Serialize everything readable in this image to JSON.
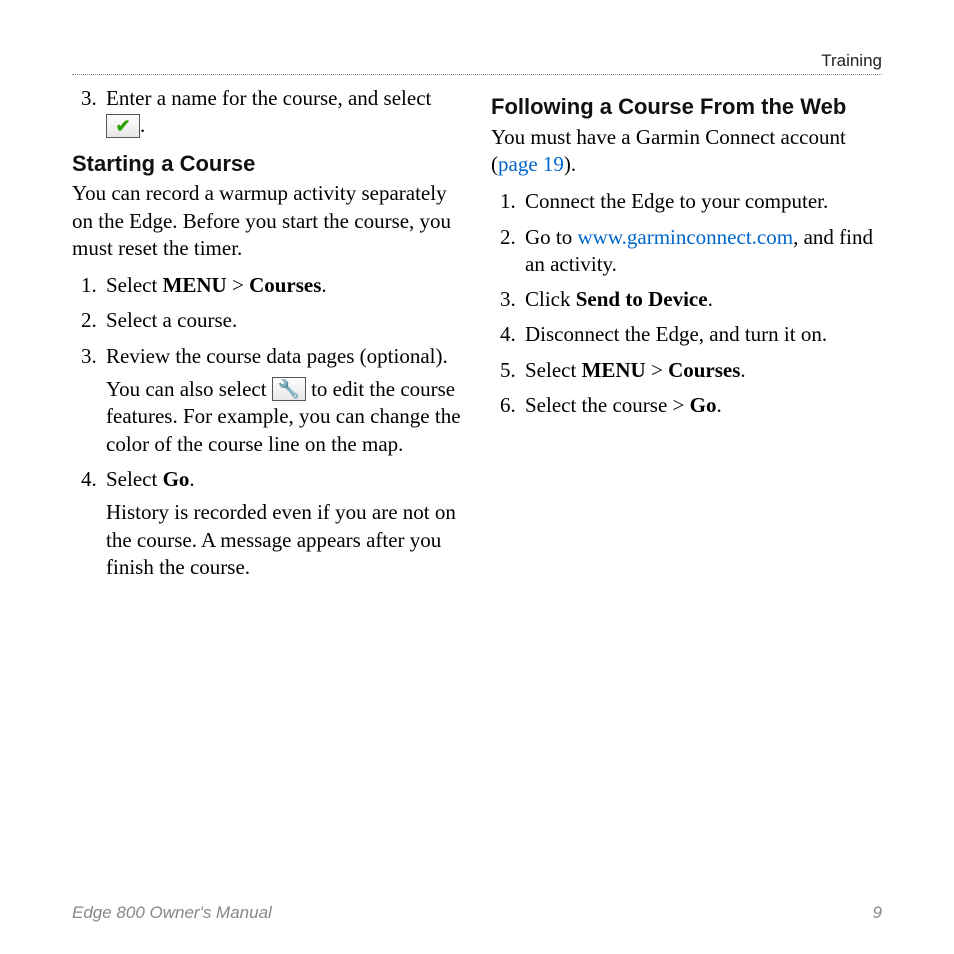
{
  "header": {
    "section": "Training"
  },
  "left": {
    "intro_item": {
      "num": "3.",
      "text_a": "Enter a name for the course, and select ",
      "text_b": "."
    },
    "heading1": "Starting a Course",
    "para1": "You can record a warmup activity separately on the Edge. Before you start the course, you must reset the timer.",
    "steps": {
      "s1": {
        "a": "Select ",
        "menu": "MENU",
        "gt": " > ",
        "courses": "Courses",
        "end": "."
      },
      "s2": "Select a course.",
      "s3": {
        "a": "Review the course data pages (optional).",
        "sub_a": "You can also select ",
        "sub_b": " to edit the course features. For example, you can change the color of the course line on the map."
      },
      "s4": {
        "a": "Select ",
        "go": "Go",
        "end": ".",
        "sub": "History is recorded even if you are not on the course. A message appears after you finish the course."
      }
    }
  },
  "right": {
    "heading1": "Following a Course From the Web",
    "para1": {
      "a": "You must have a Garmin Connect account (",
      "link": "page 19",
      "b": ")."
    },
    "steps": {
      "s1": "Connect the Edge to your computer.",
      "s2": {
        "a": "Go to ",
        "link": "www.garminconnect.com",
        "b": ", and find an activity."
      },
      "s3": {
        "a": "Click ",
        "bold": "Send to Device",
        "end": "."
      },
      "s4": "Disconnect the Edge, and turn it on.",
      "s5": {
        "a": "Select ",
        "menu": "MENU",
        "gt": " > ",
        "courses": "Courses",
        "end": "."
      },
      "s6": {
        "a": "Select the course > ",
        "go": "Go",
        "end": "."
      }
    }
  },
  "footer": {
    "title": "Edge 800 Owner's Manual",
    "page": "9"
  }
}
